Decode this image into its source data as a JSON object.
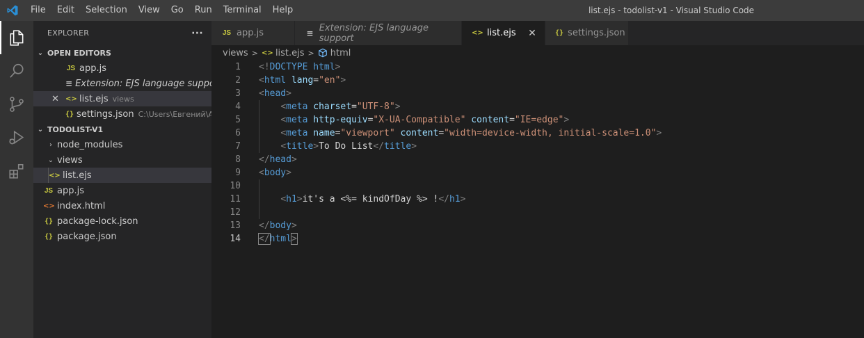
{
  "titlebar": {
    "menu": [
      "File",
      "Edit",
      "Selection",
      "View",
      "Go",
      "Run",
      "Terminal",
      "Help"
    ],
    "window_title": "list.ejs - todolist-v1 - Visual Studio Code"
  },
  "activitybar": {
    "items": [
      "explorer-icon",
      "search-icon",
      "source-control-icon",
      "run-debug-icon",
      "extensions-icon"
    ]
  },
  "sidebar": {
    "title": "EXPLORER",
    "more": "···",
    "open_editors": {
      "header": "OPEN EDITORS",
      "items": [
        {
          "icon": "JS",
          "label": "app.js",
          "desc": ""
        },
        {
          "icon": "≡",
          "label": "Extension: EJS language support",
          "desc": ""
        },
        {
          "icon": "<>",
          "label": "list.ejs",
          "desc": "views"
        },
        {
          "icon": "{}",
          "label": "settings.json",
          "desc": "C:\\Users\\Евгений\\A..."
        }
      ]
    },
    "project": {
      "header": "TODOLIST-V1",
      "items": [
        {
          "label": "node_modules"
        },
        {
          "label": "views"
        },
        {
          "icon": "<>",
          "label": "list.ejs"
        },
        {
          "icon": "JS",
          "label": "app.js"
        },
        {
          "icon": "<>",
          "label": "index.html"
        },
        {
          "icon": "{}",
          "label": "package-lock.json"
        },
        {
          "icon": "{}",
          "label": "package.json"
        }
      ]
    }
  },
  "tabs": [
    {
      "icon": "JS",
      "label": "app.js"
    },
    {
      "icon": "≡",
      "label": "Extension: EJS language support"
    },
    {
      "icon": "<>",
      "label": "list.ejs",
      "close": "✕"
    },
    {
      "icon": "{}",
      "label": "settings.json"
    }
  ],
  "breadcrumb": {
    "folder": "views",
    "file": "list.ejs",
    "symbol": "html"
  },
  "editor": {
    "line_numbers": [
      "1",
      "2",
      "3",
      "4",
      "5",
      "6",
      "7",
      "8",
      "9",
      "10",
      "11",
      "12",
      "13",
      "14"
    ],
    "current_line": "14",
    "lines": [
      "<!DOCTYPE html>",
      "<html lang=\"en\">",
      "<head>",
      "    <meta charset=\"UTF-8\">",
      "    <meta http-equiv=\"X-UA-Compatible\" content=\"IE=edge\">",
      "    <meta name=\"viewport\" content=\"width=device-width, initial-scale=1.0\">",
      "    <title>To Do List</title>",
      "</head>",
      "<body>",
      "",
      "    <h1>it's a <%= kindOfDay %> !</h1>",
      "",
      "</body>",
      "</html>"
    ]
  },
  "colors": {
    "tag_bracket": "#808080",
    "tag_name": "#569cd6",
    "attr_name": "#9cdcfe",
    "string": "#ce9178",
    "text": "#d4d4d4",
    "accent": "#007acc"
  }
}
